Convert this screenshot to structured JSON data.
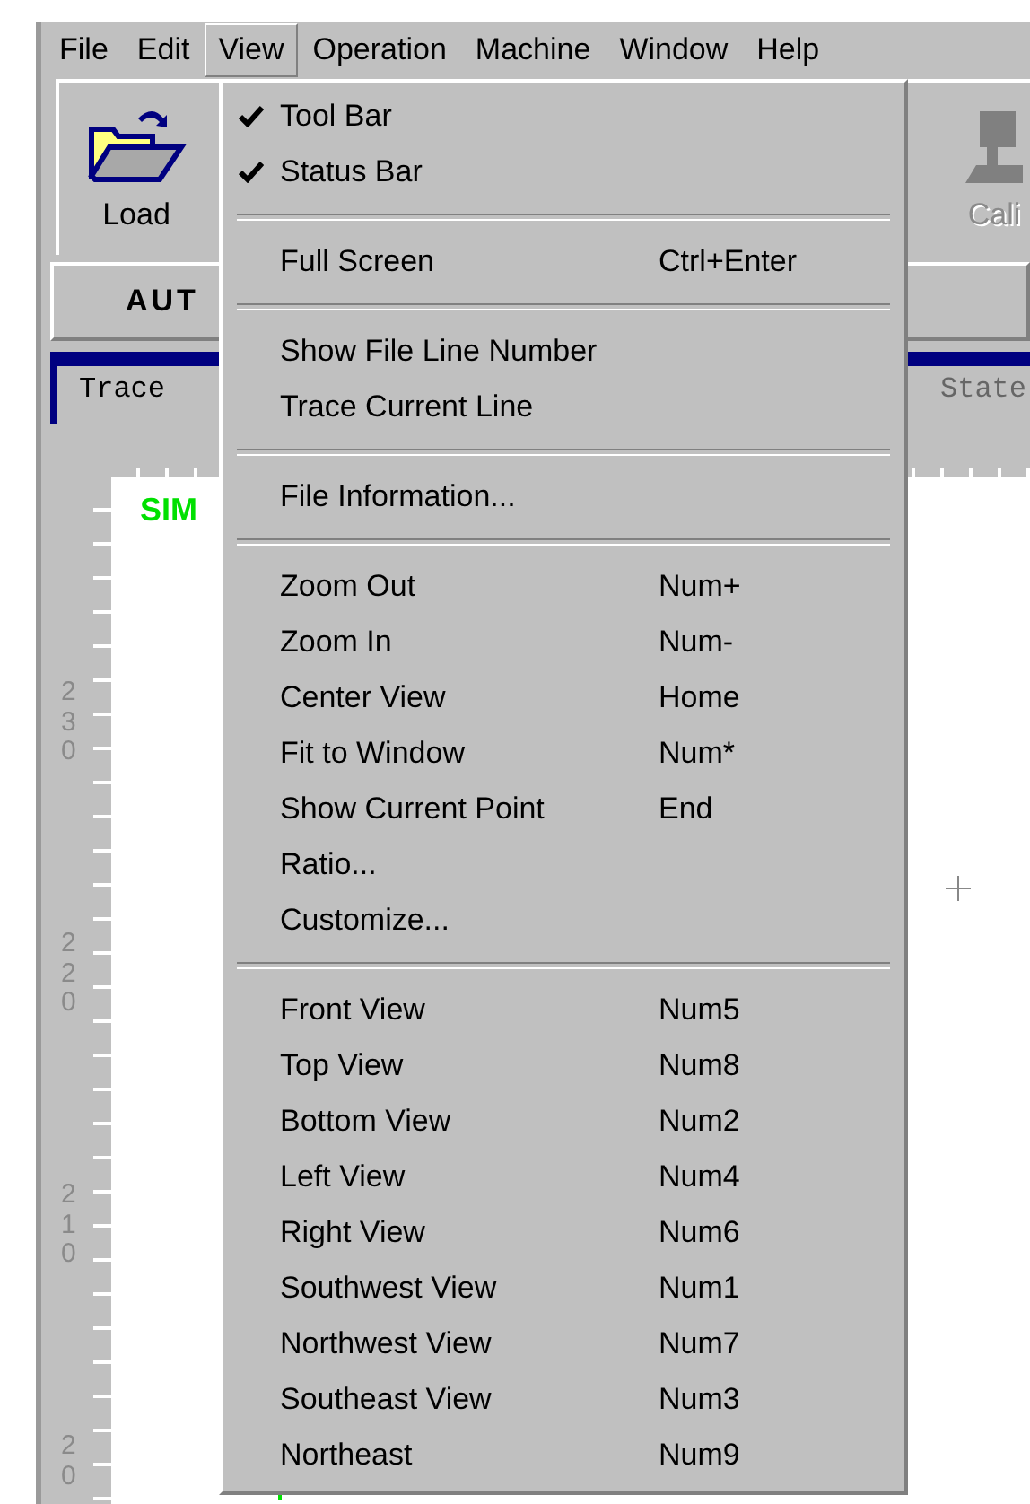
{
  "menubar": [
    {
      "label": "File",
      "selected": false
    },
    {
      "label": "Edit",
      "selected": false
    },
    {
      "label": "View",
      "selected": true
    },
    {
      "label": "Operation",
      "selected": false
    },
    {
      "label": "Machine",
      "selected": false
    },
    {
      "label": "Window",
      "selected": false
    },
    {
      "label": "Help",
      "selected": false
    }
  ],
  "toolbar": [
    {
      "label": "Load",
      "kind": "load",
      "disabled": false
    },
    {
      "label": "Cali",
      "kind": "calibrate",
      "disabled": true
    }
  ],
  "mode_label": "AUT",
  "panel_tabs": [
    {
      "label": "Trace",
      "selected": true
    },
    {
      "label": "State",
      "selected": false
    }
  ],
  "canvas": {
    "title": "SIM",
    "ruler_labels": [
      "230",
      "220",
      "210",
      "20"
    ]
  },
  "menu": {
    "groups": [
      [
        {
          "label": "Tool Bar",
          "checked": true
        },
        {
          "label": "Status Bar",
          "checked": true
        }
      ],
      [
        {
          "label": "Full Screen",
          "shortcut": "Ctrl+Enter",
          "checked": false
        }
      ],
      [
        {
          "label": "Show File Line Number",
          "checked": false
        },
        {
          "label": "Trace Current Line",
          "checked": false
        }
      ],
      [
        {
          "label": "File Information...",
          "checked": false
        }
      ],
      [
        {
          "label": "Zoom Out",
          "shortcut": "Num+",
          "checked": false
        },
        {
          "label": "Zoom In",
          "shortcut": "Num-",
          "checked": false
        },
        {
          "label": "Center View",
          "shortcut": "Home",
          "checked": false
        },
        {
          "label": "Fit to Window",
          "shortcut": "Num*",
          "checked": false
        },
        {
          "label": "Show Current Point",
          "shortcut": "End",
          "checked": false
        },
        {
          "label": "Ratio...",
          "checked": false
        },
        {
          "label": "Customize...",
          "checked": false
        }
      ],
      [
        {
          "label": "Front View",
          "shortcut": "Num5",
          "checked": false
        },
        {
          "label": "Top View",
          "shortcut": "Num8",
          "checked": false
        },
        {
          "label": "Bottom View",
          "shortcut": "Num2",
          "checked": false
        },
        {
          "label": "Left View",
          "shortcut": "Num4",
          "checked": false
        },
        {
          "label": "Right View",
          "shortcut": "Num6",
          "checked": false
        },
        {
          "label": "Southwest View",
          "shortcut": "Num1",
          "checked": false
        },
        {
          "label": "Northwest View",
          "shortcut": "Num7",
          "checked": false
        },
        {
          "label": "Southeast View",
          "shortcut": "Num3",
          "checked": false
        },
        {
          "label": "Northeast",
          "shortcut": "Num9",
          "checked": false
        }
      ]
    ]
  }
}
